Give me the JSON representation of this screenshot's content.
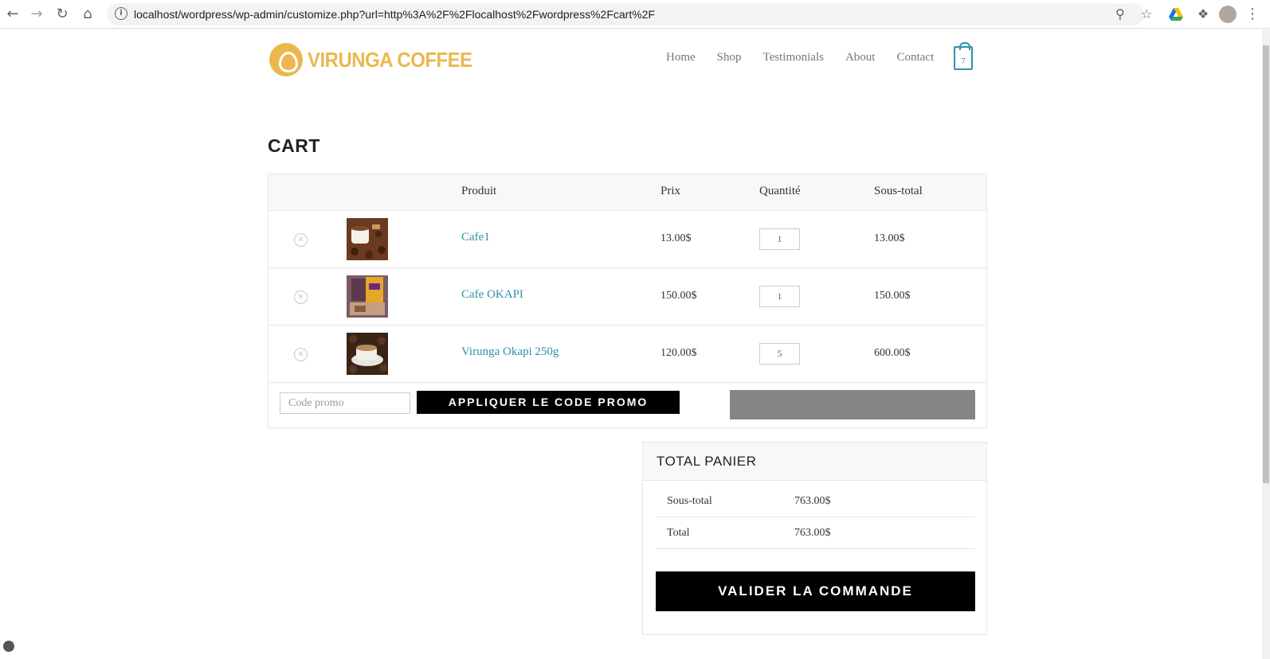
{
  "browser": {
    "url": "localhost/wordpress/wp-admin/customize.php?url=http%3A%2F%2Flocalhost%2Fwordpress%2Fcart%2F",
    "icons": [
      "back-icon",
      "forward-icon",
      "reload-icon",
      "home-icon",
      "info-icon",
      "zoom-icon",
      "star-icon",
      "drive-icon",
      "extensions-icon",
      "profile-avatar",
      "menu-icon"
    ]
  },
  "site": {
    "logo_text": "VIRUNGA COFFEE",
    "brand_color": "#eab84f",
    "accent_color": "#2a93a6",
    "menu": [
      "Home",
      "Shop",
      "Testimonials",
      "About",
      "Contact"
    ],
    "cart_count": "7"
  },
  "page": {
    "title": "CART"
  },
  "cart": {
    "columns": {
      "product": "Produit",
      "price": "Prix",
      "quantity": "Quantité",
      "subtotal": "Sous-total"
    },
    "items": [
      {
        "name": "Cafe1",
        "price": "13.00$",
        "qty": "1",
        "subtotal": "13.00$"
      },
      {
        "name": "Cafe OKAPI",
        "price": "150.00$",
        "qty": "1",
        "subtotal": "150.00$"
      },
      {
        "name": "Virunga Okapi 250g",
        "price": "120.00$",
        "qty": "5",
        "subtotal": "600.00$"
      }
    ],
    "coupon_placeholder": "Code promo",
    "coupon_button": "APPLIQUER LE CODE PROMO"
  },
  "totals": {
    "title": "TOTAL PANIER",
    "subtotal_label": "Sous-total",
    "subtotal_value": "763.00$",
    "total_label": "Total",
    "total_value": "763.00$",
    "checkout_button": "VALIDER LA COMMANDE"
  }
}
